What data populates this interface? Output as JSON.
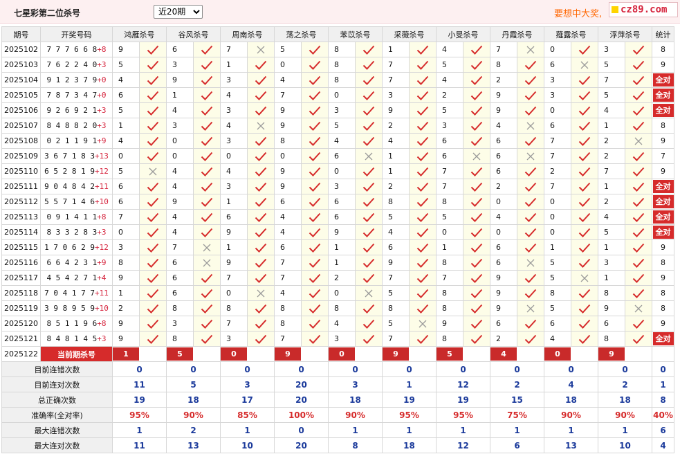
{
  "header": {
    "title": "七星彩第二位杀号",
    "period_selected": "近20期",
    "period_options": [
      "近20期"
    ],
    "promo": "要想中大奖,",
    "logo_text": "cz89.com"
  },
  "colors": {
    "accent_red": "#d62b2b",
    "summary_blue": "#1b3a9b",
    "promo_orange": "#ff6600"
  },
  "table": {
    "columns": [
      "期号",
      "开奖号码",
      "鸿雁杀号",
      "谷风杀号",
      "周南杀号",
      "荡之杀号",
      "苯苡杀号",
      "采薇杀号",
      "小旻杀号",
      "丹霞杀号",
      "薤露杀号",
      "浮萍杀号",
      "统计"
    ],
    "all_correct_label": "全对",
    "rows": [
      {
        "issue": "2025102",
        "nums": "777668",
        "plus": "+8",
        "kills": [
          "9",
          "6",
          "7",
          "5",
          "8",
          "1",
          "4",
          "7",
          "0",
          "3"
        ],
        "ok": [
          1,
          1,
          0,
          1,
          1,
          1,
          1,
          0,
          1,
          1
        ],
        "stat": "8"
      },
      {
        "issue": "2025103",
        "nums": "762240",
        "plus": "+3",
        "kills": [
          "5",
          "3",
          "1",
          "0",
          "8",
          "7",
          "5",
          "8",
          "6",
          "5"
        ],
        "ok": [
          1,
          1,
          1,
          1,
          1,
          1,
          1,
          1,
          0,
          1
        ],
        "stat": "9"
      },
      {
        "issue": "2025104",
        "nums": "912379",
        "plus": "+0",
        "kills": [
          "4",
          "9",
          "3",
          "4",
          "8",
          "7",
          "4",
          "2",
          "3",
          "7"
        ],
        "ok": [
          1,
          1,
          1,
          1,
          1,
          1,
          1,
          1,
          1,
          1
        ],
        "stat": "全对"
      },
      {
        "issue": "2025105",
        "nums": "787347",
        "plus": "+0",
        "kills": [
          "6",
          "1",
          "4",
          "7",
          "0",
          "3",
          "2",
          "9",
          "3",
          "5"
        ],
        "ok": [
          1,
          1,
          1,
          1,
          1,
          1,
          1,
          1,
          1,
          1
        ],
        "stat": "全对"
      },
      {
        "issue": "2025106",
        "nums": "926921",
        "plus": "+3",
        "kills": [
          "5",
          "4",
          "3",
          "9",
          "3",
          "9",
          "5",
          "9",
          "0",
          "4"
        ],
        "ok": [
          1,
          1,
          1,
          1,
          1,
          1,
          1,
          1,
          1,
          1
        ],
        "stat": "全对"
      },
      {
        "issue": "2025107",
        "nums": "848820",
        "plus": "+3",
        "kills": [
          "1",
          "3",
          "4",
          "9",
          "5",
          "2",
          "3",
          "4",
          "6",
          "1"
        ],
        "ok": [
          1,
          1,
          0,
          1,
          1,
          1,
          1,
          0,
          1,
          1
        ],
        "stat": "8"
      },
      {
        "issue": "2025108",
        "nums": "021191",
        "plus": "+9",
        "kills": [
          "4",
          "0",
          "3",
          "8",
          "4",
          "4",
          "6",
          "6",
          "7",
          "2"
        ],
        "ok": [
          1,
          1,
          1,
          1,
          1,
          1,
          1,
          1,
          1,
          0
        ],
        "stat": "9"
      },
      {
        "issue": "2025109",
        "nums": "367183",
        "plus": "+13",
        "kills": [
          "0",
          "0",
          "0",
          "0",
          "6",
          "1",
          "6",
          "6",
          "7",
          "2"
        ],
        "ok": [
          1,
          1,
          1,
          1,
          0,
          1,
          0,
          0,
          1,
          1
        ],
        "stat": "7"
      },
      {
        "issue": "2025110",
        "nums": "652819",
        "plus": "+12",
        "kills": [
          "5",
          "4",
          "4",
          "9",
          "0",
          "1",
          "7",
          "6",
          "2",
          "7"
        ],
        "ok": [
          0,
          1,
          1,
          1,
          1,
          1,
          1,
          1,
          1,
          1
        ],
        "stat": "9"
      },
      {
        "issue": "2025111",
        "nums": "904842",
        "plus": "+11",
        "kills": [
          "6",
          "4",
          "3",
          "9",
          "3",
          "2",
          "7",
          "2",
          "7",
          "1"
        ],
        "ok": [
          1,
          1,
          1,
          1,
          1,
          1,
          1,
          1,
          1,
          1
        ],
        "stat": "全对"
      },
      {
        "issue": "2025112",
        "nums": "557146",
        "plus": "+10",
        "kills": [
          "6",
          "9",
          "1",
          "6",
          "6",
          "8",
          "8",
          "0",
          "0",
          "2"
        ],
        "ok": [
          1,
          1,
          1,
          1,
          1,
          1,
          1,
          1,
          1,
          1
        ],
        "stat": "全对"
      },
      {
        "issue": "2025113",
        "nums": "091411",
        "plus": "+8",
        "kills": [
          "7",
          "4",
          "6",
          "4",
          "6",
          "5",
          "5",
          "4",
          "0",
          "4"
        ],
        "ok": [
          1,
          1,
          1,
          1,
          1,
          1,
          1,
          1,
          1,
          1
        ],
        "stat": "全对"
      },
      {
        "issue": "2025114",
        "nums": "833283",
        "plus": "+3",
        "kills": [
          "0",
          "4",
          "9",
          "4",
          "9",
          "4",
          "0",
          "0",
          "0",
          "5"
        ],
        "ok": [
          1,
          1,
          1,
          1,
          1,
          1,
          1,
          1,
          1,
          1
        ],
        "stat": "全对"
      },
      {
        "issue": "2025115",
        "nums": "170629",
        "plus": "+12",
        "kills": [
          "3",
          "7",
          "1",
          "6",
          "1",
          "6",
          "1",
          "6",
          "1",
          "1"
        ],
        "ok": [
          1,
          0,
          1,
          1,
          1,
          1,
          1,
          1,
          1,
          1
        ],
        "stat": "9"
      },
      {
        "issue": "2025116",
        "nums": "664231",
        "plus": "+9",
        "kills": [
          "8",
          "6",
          "9",
          "7",
          "1",
          "9",
          "8",
          "6",
          "5",
          "3"
        ],
        "ok": [
          1,
          0,
          1,
          1,
          1,
          1,
          1,
          0,
          1,
          1
        ],
        "stat": "8"
      },
      {
        "issue": "2025117",
        "nums": "454271",
        "plus": "+4",
        "kills": [
          "9",
          "6",
          "7",
          "7",
          "2",
          "7",
          "7",
          "9",
          "5",
          "1"
        ],
        "ok": [
          1,
          1,
          1,
          1,
          1,
          1,
          1,
          1,
          0,
          1
        ],
        "stat": "9"
      },
      {
        "issue": "2025118",
        "nums": "704177",
        "plus": "+11",
        "kills": [
          "1",
          "6",
          "0",
          "4",
          "0",
          "5",
          "8",
          "9",
          "8",
          "8"
        ],
        "ok": [
          1,
          1,
          0,
          1,
          0,
          1,
          1,
          1,
          1,
          1
        ],
        "stat": "8"
      },
      {
        "issue": "2025119",
        "nums": "398959",
        "plus": "+10",
        "kills": [
          "2",
          "8",
          "8",
          "8",
          "8",
          "8",
          "8",
          "9",
          "5",
          "9"
        ],
        "ok": [
          1,
          1,
          1,
          1,
          1,
          1,
          1,
          0,
          1,
          0
        ],
        "stat": "8"
      },
      {
        "issue": "2025120",
        "nums": "851196",
        "plus": "+8",
        "kills": [
          "9",
          "3",
          "7",
          "8",
          "4",
          "5",
          "9",
          "6",
          "6",
          "6"
        ],
        "ok": [
          1,
          1,
          1,
          1,
          1,
          0,
          1,
          1,
          1,
          1
        ],
        "stat": "9"
      },
      {
        "issue": "2025121",
        "nums": "848145",
        "plus": "+3",
        "kills": [
          "9",
          "8",
          "3",
          "7",
          "3",
          "7",
          "8",
          "2",
          "4",
          "8"
        ],
        "ok": [
          1,
          1,
          1,
          1,
          1,
          1,
          1,
          1,
          1,
          1
        ],
        "stat": "全对"
      }
    ],
    "current": {
      "issue": "2025122",
      "label": "当前期杀号",
      "kills": [
        "1",
        "5",
        "0",
        "9",
        "0",
        "9",
        "5",
        "4",
        "0",
        "9"
      ]
    },
    "summary": [
      {
        "label": "目前连错次数",
        "values": [
          "0",
          "0",
          "0",
          "0",
          "0",
          "0",
          "0",
          "0",
          "0",
          "0",
          "0"
        ]
      },
      {
        "label": "目前连对次数",
        "values": [
          "11",
          "5",
          "3",
          "20",
          "3",
          "1",
          "12",
          "2",
          "4",
          "2",
          "1"
        ]
      },
      {
        "label": "总正确次数",
        "values": [
          "19",
          "18",
          "17",
          "20",
          "18",
          "19",
          "19",
          "15",
          "18",
          "18",
          "8"
        ]
      },
      {
        "label": "准确率(全对率)",
        "values": [
          "95%",
          "90%",
          "85%",
          "100%",
          "90%",
          "95%",
          "95%",
          "75%",
          "90%",
          "90%",
          "40%"
        ]
      },
      {
        "label": "最大连错次数",
        "values": [
          "1",
          "2",
          "1",
          "0",
          "1",
          "1",
          "1",
          "1",
          "1",
          "1",
          "6"
        ]
      },
      {
        "label": "最大连对次数",
        "values": [
          "11",
          "13",
          "10",
          "20",
          "8",
          "18",
          "12",
          "6",
          "13",
          "10",
          "4"
        ]
      }
    ]
  }
}
